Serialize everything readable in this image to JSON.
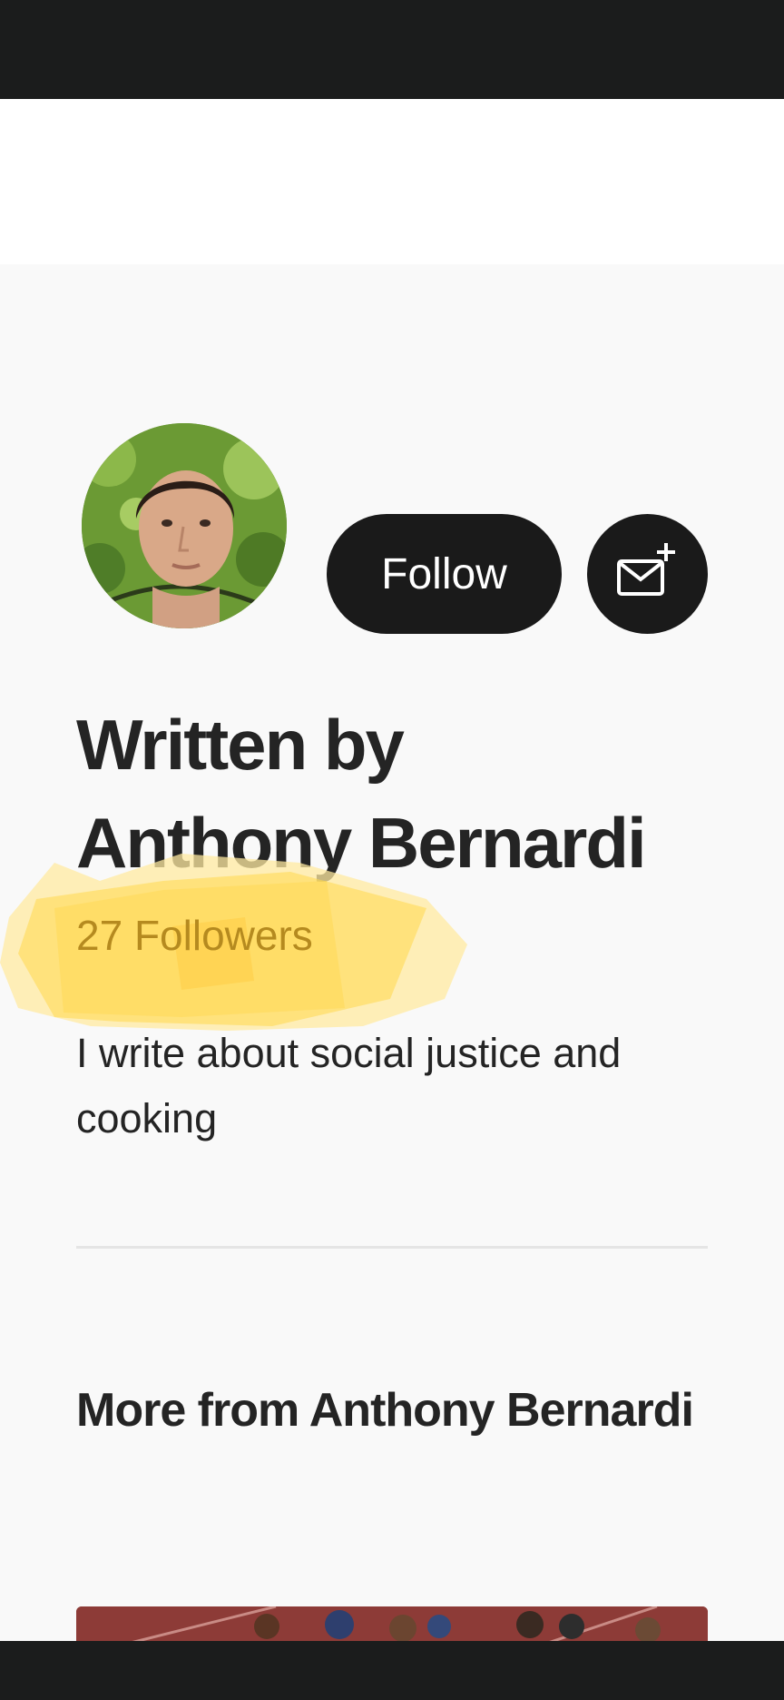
{
  "profile": {
    "follow_label": "Follow",
    "written_by_line1": "Written by",
    "author_name": "Anthony Bernardi",
    "followers_text": "27 Followers",
    "bio": "I write about social justice and cooking"
  },
  "more_section": {
    "heading": "More from Anthony Bernardi"
  },
  "icons": {
    "subscribe": "mail-plus-icon"
  },
  "colors": {
    "button_bg": "#1a1a1a",
    "highlight": "#ffd84d",
    "page_bg": "#f9f9f9"
  }
}
